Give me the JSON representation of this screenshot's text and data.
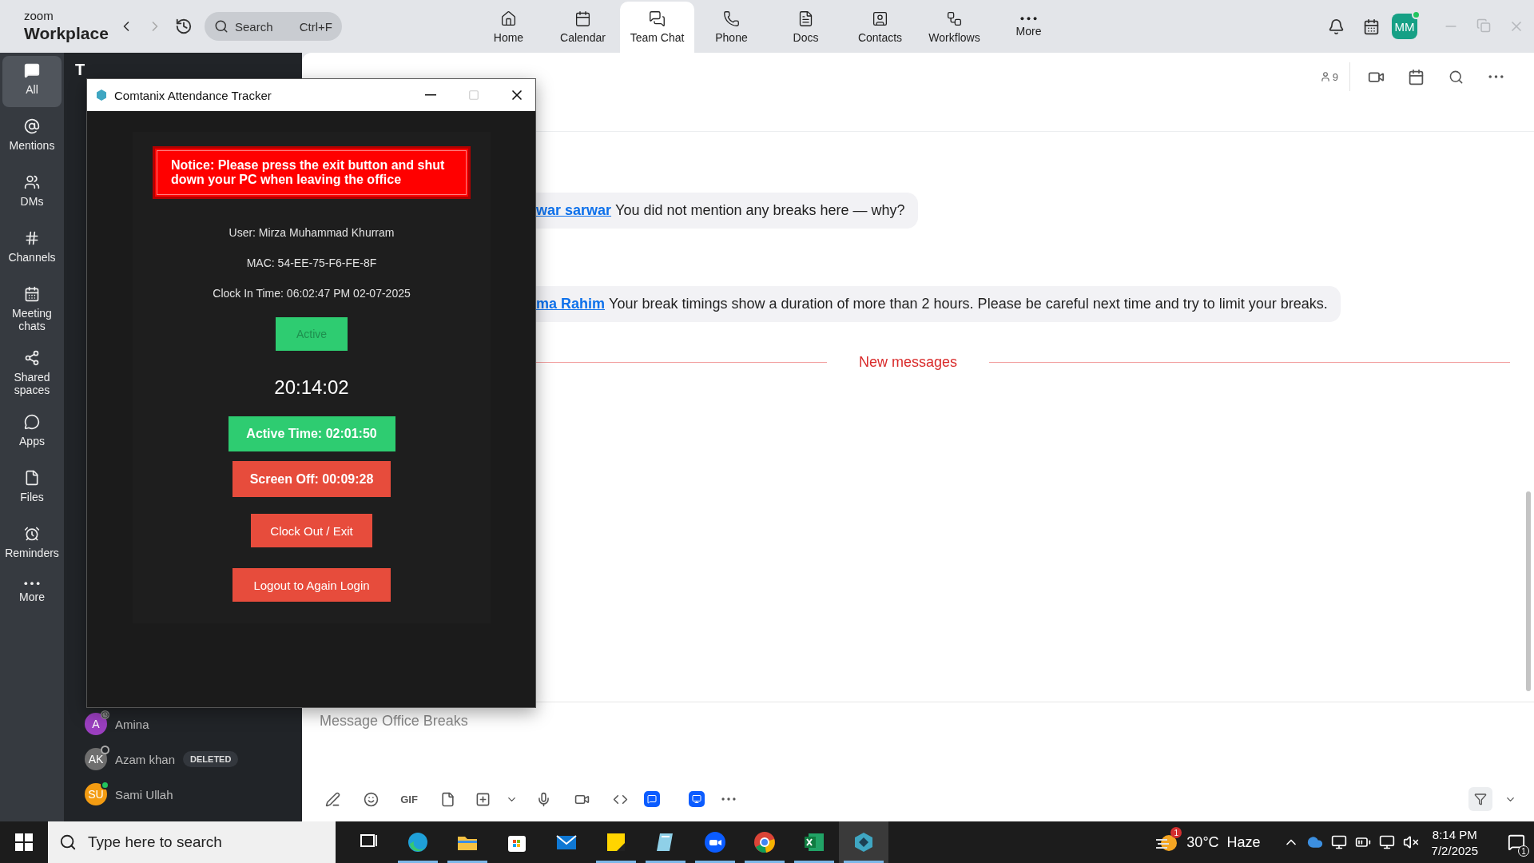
{
  "app": {
    "logo_top": "zoom",
    "logo_bottom": "Workplace"
  },
  "search": {
    "placeholder": "Search",
    "shortcut": "Ctrl+F"
  },
  "nav_tabs": [
    {
      "label": "Home",
      "selected": false
    },
    {
      "label": "Calendar",
      "selected": false
    },
    {
      "label": "Team Chat",
      "selected": true
    },
    {
      "label": "Phone",
      "selected": false
    },
    {
      "label": "Docs",
      "selected": false
    },
    {
      "label": "Contacts",
      "selected": false
    },
    {
      "label": "Workflows",
      "selected": false
    },
    {
      "label": "More",
      "selected": false
    }
  ],
  "avatar": {
    "initials": "MM",
    "online": true
  },
  "rail": [
    {
      "label": "All",
      "selected": true
    },
    {
      "label": "Mentions",
      "selected": false
    },
    {
      "label": "DMs",
      "selected": false
    },
    {
      "label": "Channels",
      "selected": false
    },
    {
      "label": "Meeting chats",
      "selected": false
    },
    {
      "label": "Shared spaces",
      "selected": false
    },
    {
      "label": "Apps",
      "selected": false
    },
    {
      "label": "Files",
      "selected": false
    },
    {
      "label": "Reminders",
      "selected": false
    },
    {
      "label": "More",
      "selected": false
    }
  ],
  "channel_panel": {
    "header": "T",
    "items": [
      {
        "initials": "A",
        "name": "Amina",
        "color": "#9b3fc0",
        "kind": "away"
      },
      {
        "initials": "AK",
        "name": "Azam khan",
        "color": "#6e6e6e",
        "kind": "offline",
        "tag": "DELETED"
      },
      {
        "initials": "SU",
        "name": "Sami Ullah",
        "color": "#f39c12",
        "kind": "online"
      }
    ]
  },
  "chat": {
    "member_count": "9",
    "messages": [
      {
        "mention": "war sarwar",
        "text": "You did not mention any breaks here — why?"
      },
      {
        "mention": "ma Rahim",
        "text": "Your break timings show a duration of more than 2 hours. Please be careful next time and try to limit your breaks."
      }
    ],
    "divider": "New messages",
    "composer": {
      "placeholder": "Message Office Breaks",
      "gif": "GIF"
    }
  },
  "tracker": {
    "title": "Comtanix Attendance Tracker",
    "notice": "Notice: Please press the exit button and shut down your PC when leaving the office",
    "info": [
      "User: Mirza Muhammad Khurram",
      "MAC: 54-EE-75-F6-FE-8F",
      "Clock In Time: 06:02:47 PM 02-07-2025"
    ],
    "status": "Active",
    "clock": "20:14:02",
    "active_time": "Active Time: 02:01:50",
    "screen_off": "Screen Off: 00:09:28",
    "buttons": [
      "Clock Out / Exit",
      "Logout to Again Login"
    ]
  },
  "taskbar": {
    "search_placeholder": "Type here to search",
    "apps": [
      {
        "running": false,
        "selected": false
      },
      {
        "running": true,
        "selected": false
      },
      {
        "running": true,
        "selected": false
      },
      {
        "running": false,
        "selected": false
      },
      {
        "running": false,
        "selected": false
      },
      {
        "running": true,
        "selected": false
      },
      {
        "running": true,
        "selected": false
      },
      {
        "running": true,
        "selected": false
      },
      {
        "running": true,
        "selected": false
      },
      {
        "running": true,
        "selected": false
      },
      {
        "running": true,
        "selected": true
      }
    ],
    "weather_badge": "1",
    "temperature": "30°C",
    "condition": "Haze",
    "time": "8:14 PM",
    "date": "7/2/2025",
    "notifications": "1"
  }
}
